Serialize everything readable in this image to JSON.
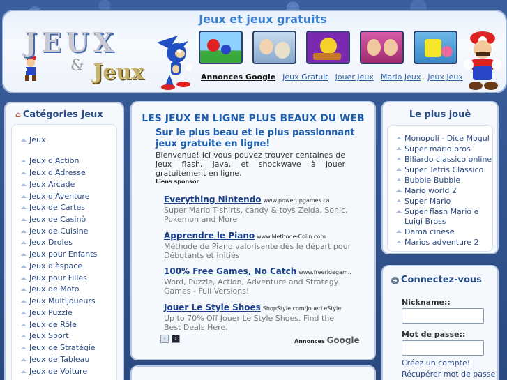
{
  "header": {
    "site_title": "Jeux et jeux gratuits",
    "logo_text_top": "JEUX",
    "logo_amp": "&",
    "logo_text_bottom": "Jeux",
    "nav": [
      {
        "label": "Annonces Google"
      },
      {
        "label": "Jeux Gratuit"
      },
      {
        "label": "Jouer Jeux"
      },
      {
        "label": "Mario Jeux"
      },
      {
        "label": "Jeux Jeux"
      }
    ]
  },
  "left": {
    "title": "Catégories Jeux",
    "categories": [
      "Jeux",
      "Jeux d'Action",
      "Jeux d'Adresse",
      "Jeux Arcade",
      "Jeux d'Aventure",
      "Jeux de Cartes",
      "Jeux de Casinò",
      "Jeux de Cuisine",
      "Jeux Droles",
      "Jeux pour Enfants",
      "Jeux d'èspace",
      "Jeux pour Filles",
      "Jeux de Moto",
      "Jeux Multijoueurs",
      "Jeux Puzzle",
      "Jeux de Rôle",
      "Jeux Sport",
      "Jeux de Stratégie",
      "Jeux de Tableau",
      "Jeux de Voiture"
    ]
  },
  "center": {
    "title": "LES JEUX EN LIGNE PLUS BEAUX DU WEB",
    "subtitle": "Sur le plus beau et le plus passionnant jeux gratuite en ligne!",
    "intro": "Bienvenue! Ici vous pouvez trouver centaines de jeux flash, java, et shockwave à jouer gratuitement en ligne.",
    "sponsor_label": "Liens sponsor",
    "ads": [
      {
        "title": "Everything Nintendo",
        "url": "www.powerupgames.ca",
        "text": "Super Mario T-shirts, candy & toys Zelda, Sonic, Pokemon and More"
      },
      {
        "title": "Apprendre le Piano",
        "url": "www.Methode-Colin.com",
        "text": "Méthode de Piano valorisante dès le départ pour Débutants et Initiés"
      },
      {
        "title": "100% Free Games, No Catch",
        "url": "www.freeridegam..",
        "text": "Word, Puzzle, Action, Adventure and Strategy Games - Full Versions!"
      },
      {
        "title": "Jouer Le Style Shoes",
        "url": "ShopStyle.com/JouerLeStyle",
        "text": "Up to 70% Off Jouer Le Style Shoes. Find the Best Deals Here."
      }
    ],
    "pager_prev": "‹",
    "pager_next": "›",
    "ads_by_prefix": "Annonces",
    "ads_by_brand": "Google"
  },
  "right": {
    "popular_title": "Le plus jouè",
    "popular": [
      "Monopoli - Dice Mogul",
      "Super mario bros",
      "Biliardo classico online",
      "Super Tetris Classico",
      "Bubble Bubble",
      "Mario world 2",
      "Super Mario",
      "Super flash Mario e Luigi Bross",
      "Dama cinese",
      "Marios adventure 2"
    ],
    "login_title": "Connectez-vous",
    "nickname_label": "Nickname::",
    "password_label": "Mot de passe::",
    "create_account": "Créez un compte!",
    "recover_password": "Récupérer mot de passe"
  },
  "colors": {
    "accent": "#1f5fb0",
    "link": "#2a4a85",
    "background": "#2e4f86"
  }
}
